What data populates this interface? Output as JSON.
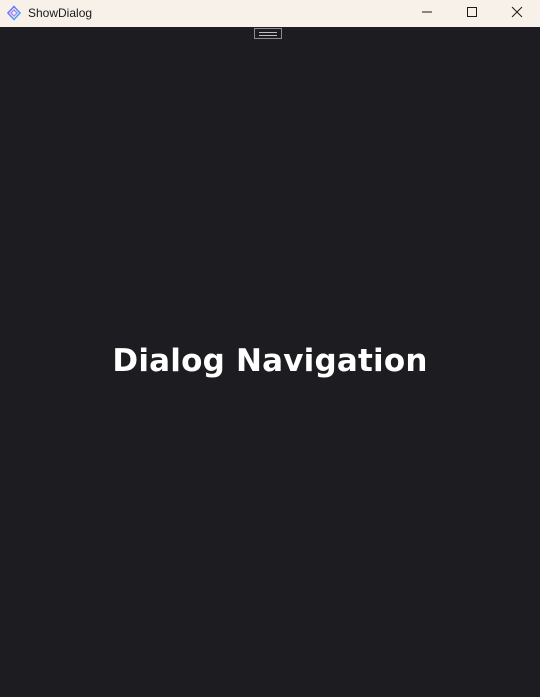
{
  "window": {
    "title": "ShowDialog",
    "icon": "app-logo-icon",
    "controls": {
      "minimize_icon": "minimize-icon",
      "maximize_icon": "maximize-icon",
      "close_icon": "close-icon"
    }
  },
  "content": {
    "heading": "Dialog Navigation",
    "grip_icon": "drag-handle-icon"
  },
  "colors": {
    "titlebar": "#f8f1e9",
    "background": "#1d1c21",
    "heading_text": "#ffffff"
  }
}
